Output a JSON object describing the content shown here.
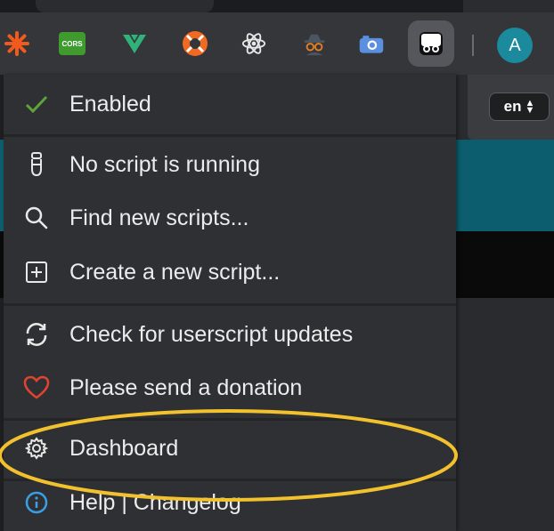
{
  "toolbar": {
    "extensions": [
      {
        "name": "orange-star-extension"
      },
      {
        "name": "cors-extension",
        "text": "CORS"
      },
      {
        "name": "vue-devtools-extension"
      },
      {
        "name": "lifebuoy-extension"
      },
      {
        "name": "react-devtools-extension"
      },
      {
        "name": "spy-extension"
      },
      {
        "name": "camera-extension"
      },
      {
        "name": "tampermonkey-extension"
      }
    ],
    "avatar_letter": "A"
  },
  "page": {
    "language": "en"
  },
  "menu": {
    "items": [
      {
        "label": "Enabled",
        "icon": "check-icon"
      },
      {
        "label": "No script is running",
        "icon": "script-icon"
      },
      {
        "label": "Find new scripts...",
        "icon": "search-icon"
      },
      {
        "label": "Create a new script...",
        "icon": "plus-square-icon"
      },
      {
        "label": "Check for userscript updates",
        "icon": "refresh-icon"
      },
      {
        "label": "Please send a donation",
        "icon": "heart-icon"
      },
      {
        "label": "Dashboard",
        "icon": "gear-icon"
      },
      {
        "label": "Help | Changelog",
        "icon": "info-icon"
      }
    ]
  },
  "colors": {
    "highlight_ellipse": "#f2c12e",
    "check": "#5fa33a",
    "heart": "#e0442f",
    "info": "#3aa0e6"
  }
}
